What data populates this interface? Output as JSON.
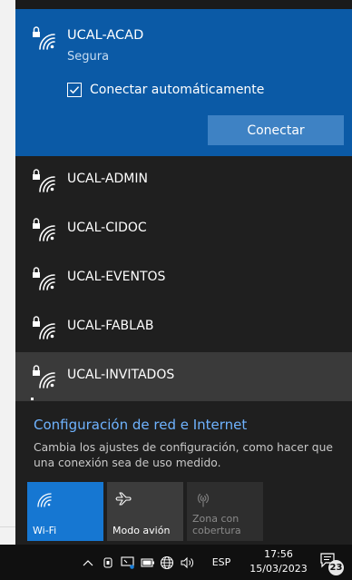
{
  "networks": {
    "selected": {
      "ssid": "UCAL-ACAD",
      "status": "Segura",
      "auto_connect_label": "Conectar automáticamente",
      "auto_connect_checked": true,
      "connect_button": "Conectar"
    },
    "list": [
      {
        "ssid": "UCAL-ADMIN"
      },
      {
        "ssid": "UCAL-CIDOC"
      },
      {
        "ssid": "UCAL-EVENTOS"
      },
      {
        "ssid": "UCAL-FABLAB"
      },
      {
        "ssid": "UCAL-INVITADOS"
      }
    ]
  },
  "settings": {
    "link": "Configuración de red e Internet",
    "description": "Cambia los ajustes de configuración, como hacer que una conexión sea de uso medido."
  },
  "quick_actions": {
    "wifi": {
      "label": "Wi-Fi",
      "active": true
    },
    "airplane": {
      "label": "Modo avión",
      "active": false
    },
    "hotspot": {
      "label": "Zona con cobertura",
      "enabled": false
    }
  },
  "taskbar": {
    "language": "ESP",
    "time": "17:56",
    "date": "15/03/2023",
    "notification_count": "23"
  },
  "colors": {
    "selected_bg": "#0b5aa6",
    "accent": "#1677d2",
    "panel_bg": "#1f1f1f",
    "link": "#6fb3ff"
  }
}
